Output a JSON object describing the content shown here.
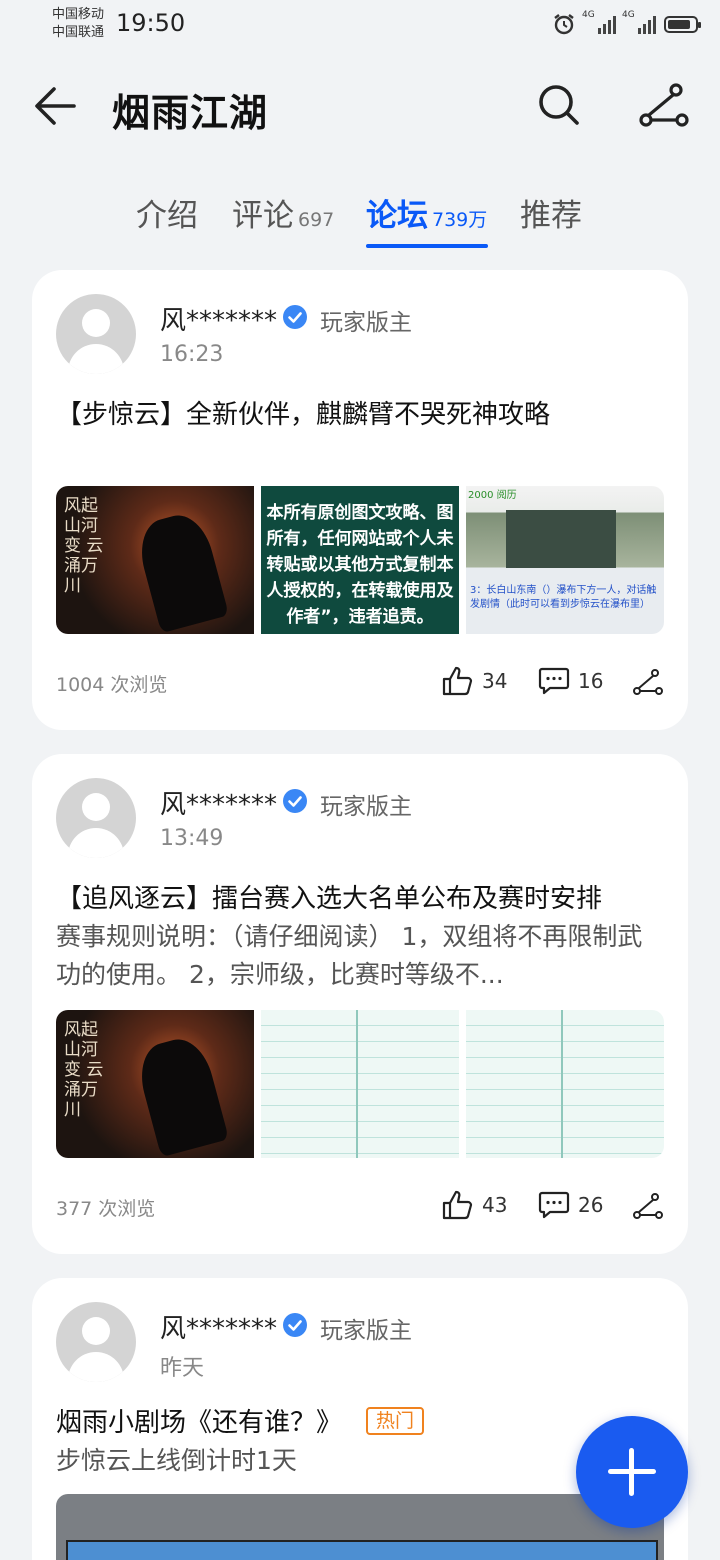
{
  "status_bar": {
    "carrier1": "中国移动",
    "carrier2": "中国联通",
    "time": "19:50",
    "net1": "4G",
    "net2": "4G"
  },
  "header": {
    "title": "烟雨江湖"
  },
  "tabs": [
    {
      "label": "介绍",
      "count": ""
    },
    {
      "label": "评论",
      "count": "697"
    },
    {
      "label": "论坛",
      "count": "739万",
      "active": true
    },
    {
      "label": "推荐",
      "count": ""
    }
  ],
  "posts": [
    {
      "author": "风*******",
      "role": "玩家版主",
      "time": "16:23",
      "title": "【步惊云】全新伙伴，麒麟臂不哭死神攻略",
      "desc": "",
      "views": "1004 次浏览",
      "likes": "34",
      "comments": "16",
      "images": {
        "img1_text": "风起山河变 云涌万川",
        "img2_text": "本所有原创图文攻略、图所有，任何网站或个人未转贴或以其他方式复制本人授权的，在转载使用及作者”，违者追责。",
        "img3_top": "2000 阅历",
        "img3_text": "3：长白山东南（）瀑布下方一人，对话触发剧情（此时可以看到步惊云在瀑布里）"
      }
    },
    {
      "author": "风*******",
      "role": "玩家版主",
      "time": "13:49",
      "title": "【追风逐云】擂台赛入选大名单公布及赛时安排",
      "desc": " 赛事规则说明：（请仔细阅读） 1，双组将不再限制武功的使用。 2，宗师级，比赛时等级不...",
      "views": "377 次浏览",
      "likes": "43",
      "comments": "26",
      "images": {
        "img1_text": "风起山河变 云涌万川"
      }
    },
    {
      "author": "风*******",
      "role": "玩家版主",
      "time": "昨天",
      "title": "烟雨小剧场《还有谁？》",
      "badge": "热门",
      "desc": "步惊云上线倒计时1天"
    }
  ],
  "colors": {
    "accent": "#0a59f7",
    "fab": "#1a5bf0",
    "hot_badge": "#f0821e",
    "verified": "#3a87f5"
  }
}
